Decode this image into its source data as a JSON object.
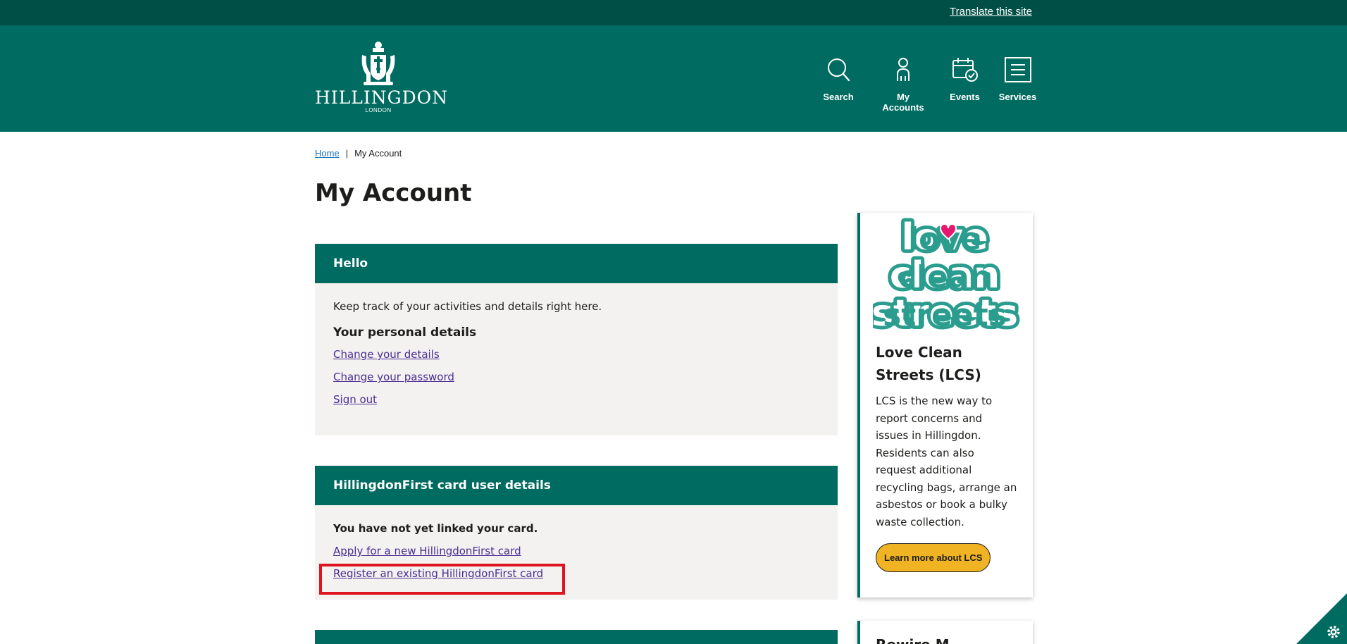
{
  "topbar": {
    "translate_link": "Translate this site"
  },
  "header": {
    "logo_text": "HILLINGDON",
    "logo_sub": "LONDON",
    "nav": [
      {
        "label": "Search",
        "icon": "search-icon"
      },
      {
        "label": "My Accounts",
        "icon": "user-icon"
      },
      {
        "label": "Events",
        "icon": "calendar-check-icon"
      },
      {
        "label": "Services",
        "icon": "menu-icon"
      }
    ]
  },
  "breadcrumb": {
    "home": "Home",
    "separator": "|",
    "current": "My Account"
  },
  "page_title": "My Account",
  "hello_panel": {
    "heading": "Hello",
    "intro": "Keep track of your activities and details right here.",
    "subheading": "Your personal details",
    "links": [
      "Change your details",
      "Change your password",
      "Sign out"
    ]
  },
  "card_panel": {
    "heading": "HillingdonFirst card user details",
    "status": "You have not yet linked your card.",
    "links": [
      "Apply for a new HillingdonFirst card",
      "Register an existing HillingdonFirst card"
    ]
  },
  "sidebar": {
    "lcs": {
      "logo_words": [
        "love",
        "clean",
        "streets"
      ],
      "title": "Love Clean Streets (LCS)",
      "body": "LCS is the new way to report concerns and issues in Hillingdon. Residents can also request additional recycling bags, arrange an asbestos or book a bulky waste collection.",
      "button": "Learn more about LCS"
    },
    "second_title": "Rewire M"
  },
  "colors": {
    "brand_green": "#006b60",
    "topbar_green": "#004f46",
    "panel_bg": "#f3f2f1",
    "link_purple": "#4c2c92",
    "button_yellow": "#f0b323",
    "highlight_red": "#e0141e",
    "lcs_teal": "#2a9d8f",
    "lcs_pink": "#e5176f"
  }
}
